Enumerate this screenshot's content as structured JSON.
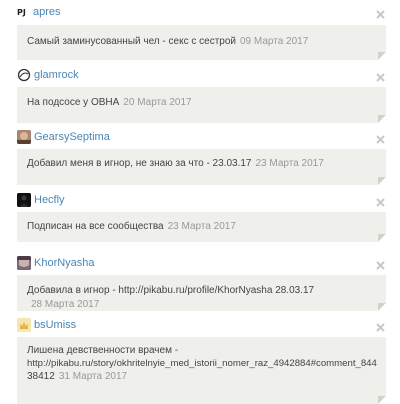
{
  "entries": [
    {
      "username": "apres",
      "avatar": "pj-avatar",
      "avatar_text": "PJ",
      "message": "Самый заминусованный чел - секс с сестрой",
      "date": "09 Марта 2017"
    },
    {
      "username": "glamrock",
      "avatar": "glamrock-avatar",
      "message": "На подсосе у ОВНА",
      "date": "20 Марта 2017"
    },
    {
      "username": "GearsySeptima",
      "avatar": "gearsyseptima-avatar",
      "message": "Добавил меня в игнор, не знаю за что - 23.03.17",
      "date": "23 Марта 2017"
    },
    {
      "username": "Hecfly",
      "avatar": "hecfly-avatar",
      "message": "Подписан на все сообщества",
      "date": "23 Марта 2017"
    },
    {
      "username": "KhorNyasha",
      "avatar": "khornyasha-avatar",
      "message": "Добавила в игнор - http://pikabu.ru/profile/KhorNyasha 28.03.17",
      "date": "28 Марта 2017"
    },
    {
      "username": "bsUmiss",
      "avatar": "bsumiss-avatar",
      "message_line1": "Лишена девственности врачем -",
      "message_line2": "http://pikabu.ru/story/okhritelnyie_med_istorii_nomer_raz_4942884#comment_844",
      "message_line3": "38412",
      "date": "31 Марта 2017"
    }
  ],
  "colors": {
    "username": "#4a86b5",
    "card_bg": "#efefeb",
    "text": "#444444",
    "date": "#999999",
    "close": "#c8c8c8"
  }
}
